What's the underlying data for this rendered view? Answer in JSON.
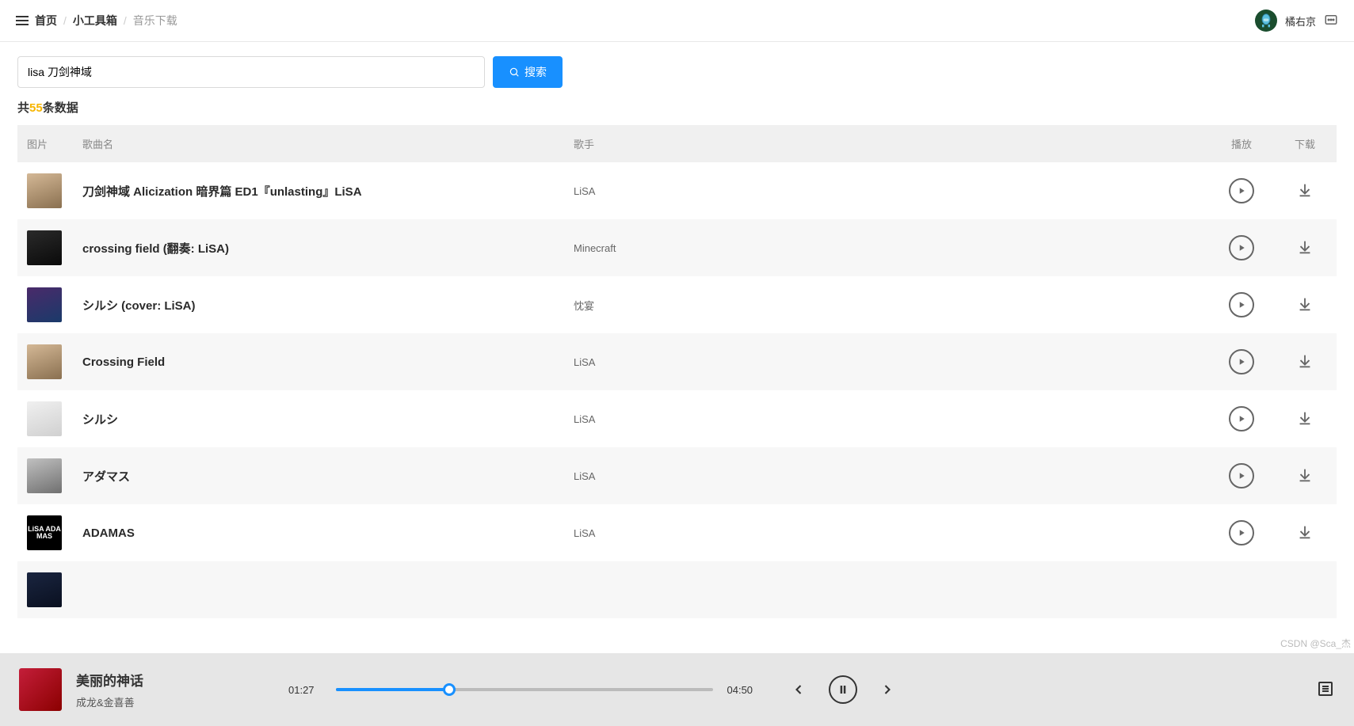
{
  "breadcrumb": {
    "home": "首页",
    "toolbox": "小工具箱",
    "current": "音乐下载"
  },
  "user": {
    "name": "橘右京"
  },
  "search": {
    "value": "lisa 刀剑神域",
    "button": "搜索"
  },
  "count": {
    "prefix": "共",
    "num": "55",
    "suffix": "条数据"
  },
  "columns": {
    "img": "图片",
    "song": "歌曲名",
    "artist": "歌手",
    "play": "播放",
    "download": "下载"
  },
  "songs": [
    {
      "name": "刀剑神域 Alicization 暗界篇 ED1『unlasting』LiSA",
      "artist": "LiSA",
      "art": "art1"
    },
    {
      "name": "crossing field (翻奏: LiSA)",
      "artist": "Minecraft",
      "art": "art2"
    },
    {
      "name": "シルシ (cover: LiSA)",
      "artist": "忱宴",
      "art": "art3"
    },
    {
      "name": "Crossing Field",
      "artist": "LiSA",
      "art": "art4"
    },
    {
      "name": "シルシ",
      "artist": "LiSA",
      "art": "art5"
    },
    {
      "name": "アダマス",
      "artist": "LiSA",
      "art": "art6"
    },
    {
      "name": "ADAMAS",
      "artist": "LiSA",
      "art": "art7"
    },
    {
      "name": "",
      "artist": "",
      "art": "art8"
    }
  ],
  "player": {
    "title": "美丽的神话",
    "artist": "成龙&金喜善",
    "current": "01:27",
    "total": "04:50",
    "percent": 30
  },
  "watermark": "CSDN @Sca_杰",
  "artLabel": "LiSA ADA MAS"
}
